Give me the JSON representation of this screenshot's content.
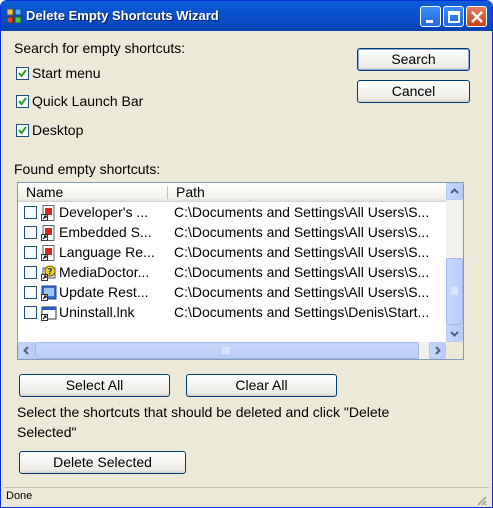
{
  "window": {
    "title": "Delete Empty Shortcuts Wizard"
  },
  "search_group": {
    "label": "Search for empty shortcuts:",
    "options": [
      {
        "label": "Start menu",
        "checked": true
      },
      {
        "label": "Quick Launch Bar",
        "checked": true
      },
      {
        "label": "Desktop",
        "checked": true
      }
    ]
  },
  "buttons": {
    "search": "Search",
    "cancel": "Cancel",
    "select_all": "Select All",
    "clear_all": "Clear All",
    "delete_selected": "Delete Selected"
  },
  "found": {
    "label": "Found empty shortcuts:",
    "columns": [
      "Name",
      "Path"
    ],
    "rows": [
      {
        "name": "Developer's ...",
        "path": "C:\\Documents and Settings\\All Users\\S...",
        "icon": "pdf-shortcut-icon",
        "checked": false
      },
      {
        "name": "Embedded S...",
        "path": "C:\\Documents and Settings\\All Users\\S...",
        "icon": "pdf-shortcut-icon",
        "checked": false
      },
      {
        "name": "Language Re...",
        "path": "C:\\Documents and Settings\\All Users\\S...",
        "icon": "pdf-shortcut-icon",
        "checked": false
      },
      {
        "name": "MediaDoctor...",
        "path": "C:\\Documents and Settings\\All Users\\S...",
        "icon": "help-shortcut-icon",
        "checked": false
      },
      {
        "name": "Update Rest...",
        "path": "C:\\Documents and Settings\\All Users\\S...",
        "icon": "app-shortcut-icon",
        "checked": false
      },
      {
        "name": "Uninstall.lnk",
        "path": "C:\\Documents and Settings\\Denis\\Start...",
        "icon": "window-shortcut-icon",
        "checked": false
      }
    ]
  },
  "instruction": {
    "line1": "Select the shortcuts that should be deleted and click \"Delete",
    "line2": "Selected\""
  },
  "status": "Done"
}
